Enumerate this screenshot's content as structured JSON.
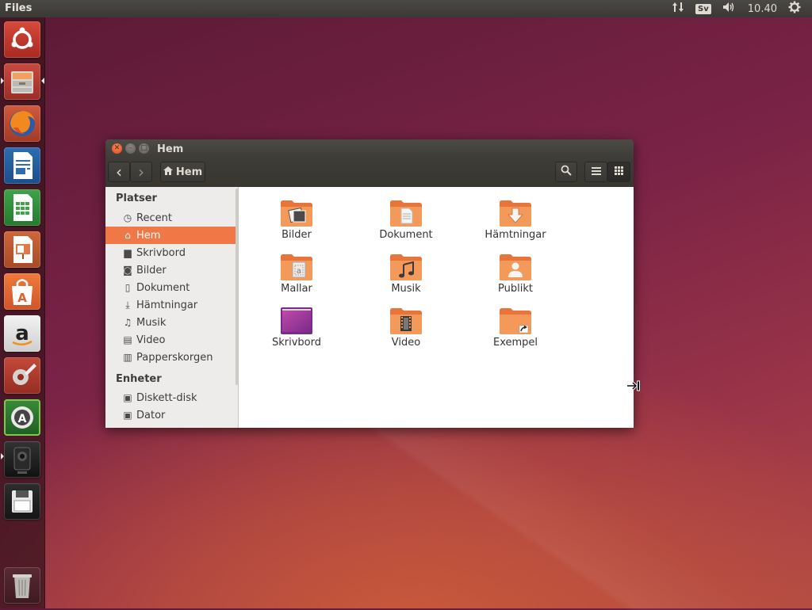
{
  "top_panel": {
    "app_name": "Files",
    "keyboard_layout": "Sv",
    "clock": "10.40",
    "icons": [
      "network-updown-icon",
      "keyboard-indicator",
      "volume-icon",
      "gear-icon"
    ]
  },
  "launcher": {
    "items": [
      {
        "name": "ubuntu-dash",
        "icon": "ubuntu-logo-icon"
      },
      {
        "name": "files",
        "icon": "file-cabinet-icon",
        "running": true,
        "focused": true
      },
      {
        "name": "firefox",
        "icon": "firefox-icon"
      },
      {
        "name": "libreoffice-writer",
        "icon": "writer-icon"
      },
      {
        "name": "libreoffice-calc",
        "icon": "calc-icon"
      },
      {
        "name": "libreoffice-impress",
        "icon": "impress-icon"
      },
      {
        "name": "software-center",
        "icon": "shopping-bag-icon"
      },
      {
        "name": "amazon",
        "icon": "amazon-icon"
      },
      {
        "name": "system-settings",
        "icon": "settings-wrench-icon"
      },
      {
        "name": "software-updater",
        "icon": "updater-icon"
      },
      {
        "name": "webcam",
        "icon": "webcam-icon",
        "running": true
      },
      {
        "name": "floppy",
        "icon": "floppy-icon"
      },
      {
        "name": "trash",
        "icon": "trash-icon"
      }
    ]
  },
  "window": {
    "title": "Hem",
    "toolbar": {
      "back": "‹",
      "forward": "›",
      "breadcrumb": "Hem",
      "search_icon": "search-icon",
      "list_view_icon": "list-view-icon",
      "grid_view_icon": "grid-view-icon"
    },
    "sidebar": {
      "sections": [
        {
          "heading": "Platser",
          "items": [
            {
              "label": "Recent",
              "icon": "clock-icon",
              "glyph": "◷"
            },
            {
              "label": "Hem",
              "icon": "home-icon",
              "glyph": "⌂",
              "active": true
            },
            {
              "label": "Skrivbord",
              "icon": "folder-icon",
              "glyph": "▆"
            },
            {
              "label": "Bilder",
              "icon": "camera-icon",
              "glyph": "◙"
            },
            {
              "label": "Dokument",
              "icon": "document-icon",
              "glyph": "▯"
            },
            {
              "label": "Hämtningar",
              "icon": "download-icon",
              "glyph": "⤓"
            },
            {
              "label": "Musik",
              "icon": "music-icon",
              "glyph": "♫"
            },
            {
              "label": "Video",
              "icon": "film-icon",
              "glyph": "▤"
            },
            {
              "label": "Papperskorgen",
              "icon": "trash-icon",
              "glyph": "▥"
            }
          ]
        },
        {
          "heading": "Enheter",
          "items": [
            {
              "label": "Diskett-disk",
              "icon": "floppy-icon",
              "glyph": "▣"
            },
            {
              "label": "Dator",
              "icon": "computer-icon",
              "glyph": "▣"
            }
          ]
        }
      ]
    },
    "folders": [
      {
        "label": "Bilder",
        "icon": "pictures-folder-icon"
      },
      {
        "label": "Dokument",
        "icon": "documents-folder-icon"
      },
      {
        "label": "Hämtningar",
        "icon": "downloads-folder-icon"
      },
      {
        "label": "Mallar",
        "icon": "templates-folder-icon"
      },
      {
        "label": "Musik",
        "icon": "music-folder-icon"
      },
      {
        "label": "Publikt",
        "icon": "public-folder-icon"
      },
      {
        "label": "Skrivbord",
        "icon": "desktop-folder-icon"
      },
      {
        "label": "Video",
        "icon": "videos-folder-icon"
      },
      {
        "label": "Exempel",
        "icon": "examples-folder-link-icon"
      }
    ]
  },
  "colors": {
    "accent": "#f07746",
    "folder_orange": "#e8743a",
    "panel_dark": "#3b3935"
  }
}
